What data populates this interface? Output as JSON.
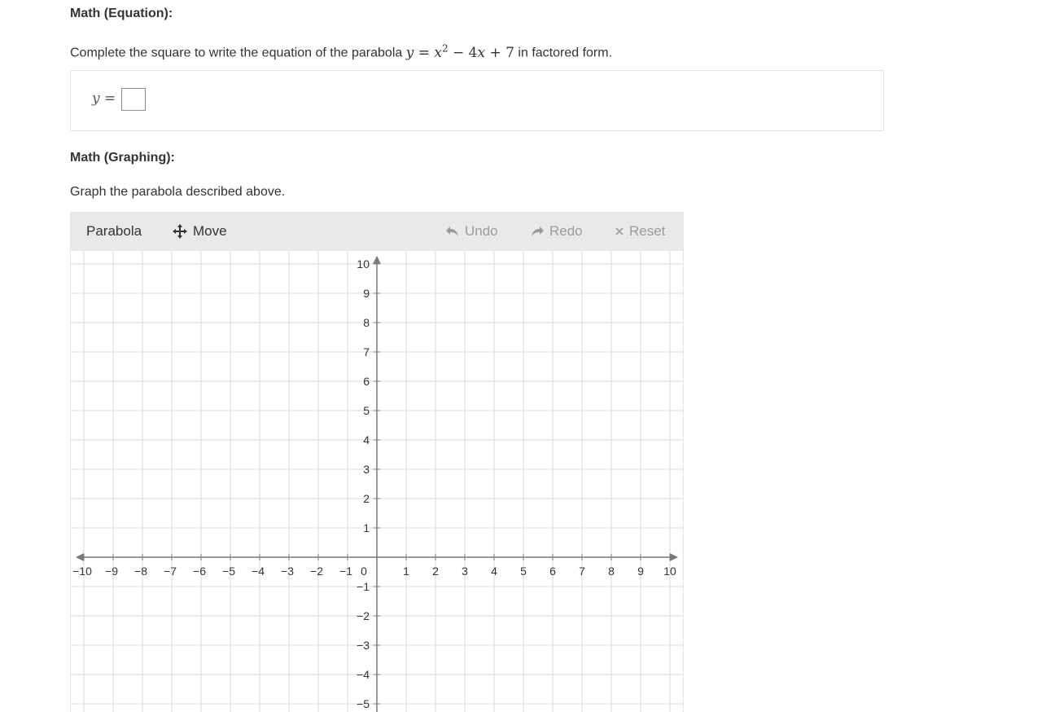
{
  "equation_section": {
    "heading": "Math (Equation):",
    "prompt_before": "Complete the square to write the equation of the parabola ",
    "math_y": "y",
    "math_eq": " = ",
    "math_x": "x",
    "math_exp": "2",
    "math_rest_1": " − 4",
    "math_x2": "x",
    "math_rest_2": " + 7",
    "prompt_after": " in factored form.",
    "answer_label_var": "y",
    "answer_label_eq": " =",
    "answer_value": ""
  },
  "graphing_section": {
    "heading": "Math (Graphing):",
    "prompt": "Graph the parabola described above."
  },
  "toolbar": {
    "parabola_label": "Parabola",
    "move_label": "Move",
    "undo_label": "Undo",
    "redo_label": "Redo",
    "reset_label": "Reset",
    "icons": {
      "move": "move-arrows-icon",
      "undo": "undo-arrow-icon",
      "redo": "redo-arrow-icon",
      "reset": "close-x-icon"
    }
  },
  "chart_data": {
    "type": "scatter",
    "xlim": [
      -10,
      10
    ],
    "ylim": [
      -10,
      10
    ],
    "x_ticks": [
      -10,
      -9,
      -8,
      -7,
      -6,
      -5,
      -4,
      -3,
      -2,
      -1,
      0,
      1,
      2,
      3,
      4,
      5,
      6,
      7,
      8,
      9,
      10
    ],
    "y_ticks": [
      10,
      9,
      8,
      7,
      6,
      5,
      4,
      3,
      2,
      1,
      -1,
      -2,
      -3,
      -4,
      -5
    ],
    "grid": true,
    "series": []
  },
  "colors": {
    "grid": "#d9d9d9",
    "axis": "#7a7a7a",
    "tick_label": "#333333",
    "toolbar_bg": "#e9e9e9",
    "disabled_text": "#9a9a9a"
  }
}
